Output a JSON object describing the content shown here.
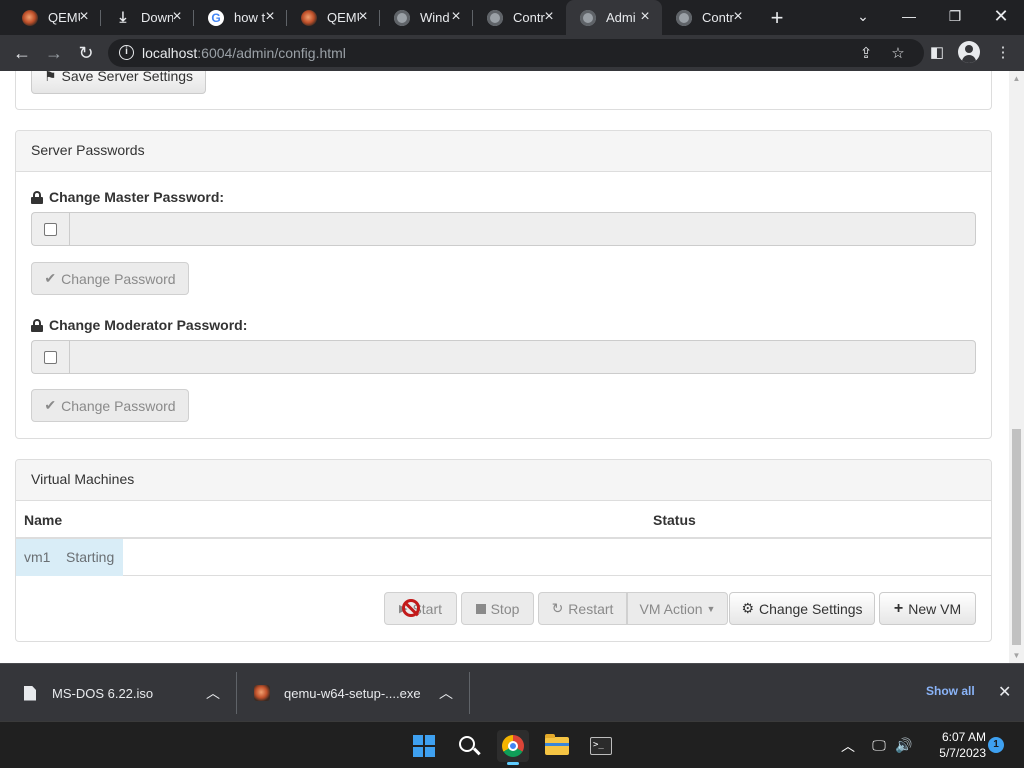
{
  "browser": {
    "tabs": [
      {
        "title": "QEMU",
        "icon": "qemu-icon"
      },
      {
        "title": "Down",
        "icon": "download-icon"
      },
      {
        "title": "how t",
        "icon": "google-icon"
      },
      {
        "title": "QEMU",
        "icon": "qemu-icon"
      },
      {
        "title": "Wind",
        "icon": "globe-icon"
      },
      {
        "title": "Contr",
        "icon": "globe-icon"
      },
      {
        "title": "Admi",
        "icon": "globe-icon",
        "active": true
      },
      {
        "title": "Contr",
        "icon": "globe-icon"
      }
    ],
    "url_host": "localhost",
    "url_rest": ":6004/admin/config.html"
  },
  "server_settings": {
    "save_label": "Save Server Settings"
  },
  "passwords": {
    "heading": "Server Passwords",
    "master": {
      "label": "Change Master Password:",
      "value": "",
      "button": "Change Password"
    },
    "moderator": {
      "label": "Change Moderator Password:",
      "value": "",
      "button": "Change Password"
    }
  },
  "vms": {
    "heading": "Virtual Machines",
    "columns": [
      "Name",
      "Status"
    ],
    "rows": [
      {
        "name": "vm1",
        "status": "Starting"
      }
    ],
    "buttons": {
      "start": "Start",
      "stop": "Stop",
      "restart": "Restart",
      "vm_action": "VM Action",
      "change_settings": "Change Settings",
      "new_vm": "New VM"
    }
  },
  "downloads": {
    "items": [
      {
        "name": "MS-DOS 6.22.iso",
        "icon": "file-icon"
      },
      {
        "name": "qemu-w64-setup-....exe",
        "icon": "qemu-icon"
      }
    ],
    "show_all": "Show all"
  },
  "taskbar": {
    "time": "6:07 AM",
    "date": "5/7/2023",
    "notifications": "1"
  },
  "colors": {
    "selected_row": "#d9edf7",
    "panel_heading": "#f5f5f5",
    "chrome_dark": "#202124",
    "link_blue": "#8ab4f8"
  }
}
